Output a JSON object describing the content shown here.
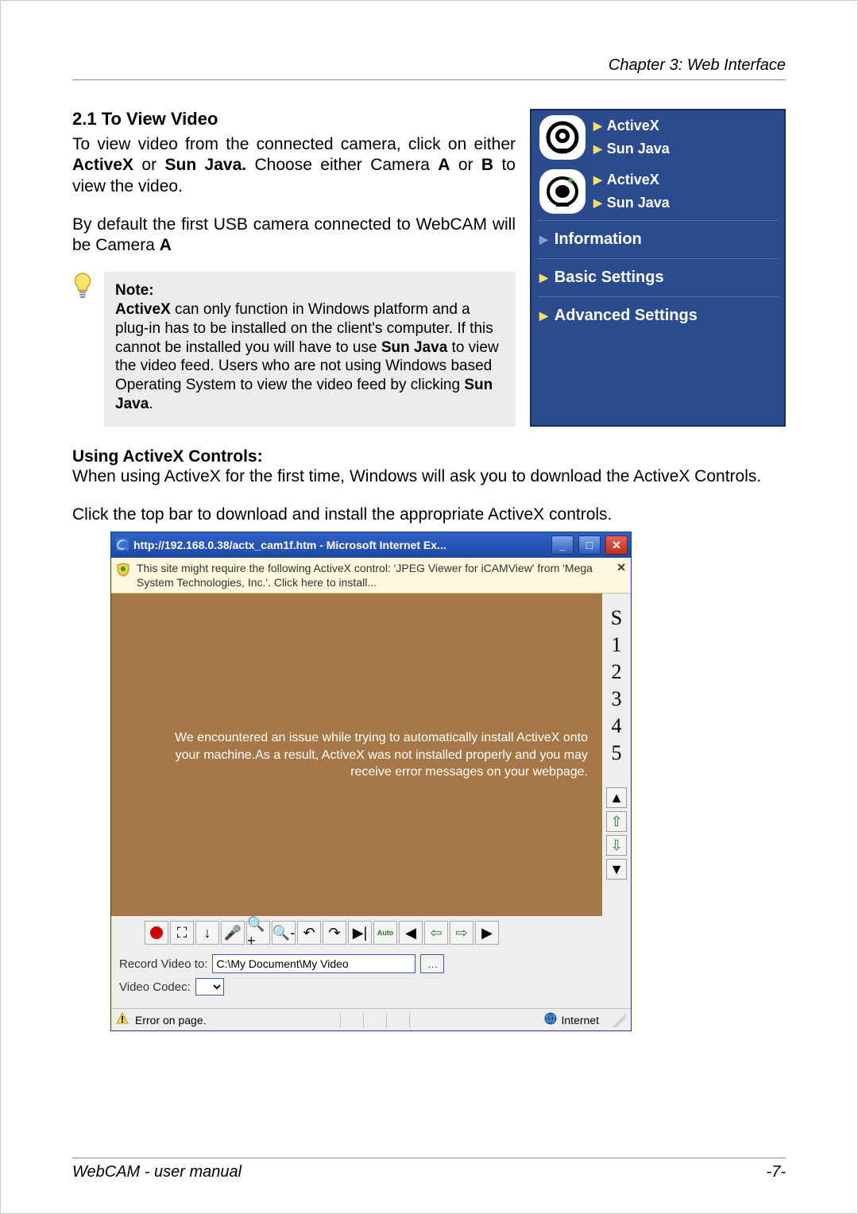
{
  "page": {
    "header_right": "Chapter 3: Web Interface",
    "footer_left": "WebCAM - user manual",
    "footer_right": "-7-"
  },
  "section": {
    "title": "2.1 To View Video",
    "p1_a": "To view video from the connected camera, click on either ",
    "p1_b": "ActiveX",
    "p1_c": " or ",
    "p1_d": "Sun Java.",
    "p1_e": "   Choose either Camera ",
    "p1_f": "A",
    "p1_g": " or ",
    "p1_h": "B",
    "p1_i": " to view the video.",
    "p2_a": "By default the first USB camera connected to WebCAM will be Camera ",
    "p2_b": "A"
  },
  "sidebar": {
    "cam1": {
      "activex": "ActiveX",
      "sunjava": "Sun Java"
    },
    "cam2": {
      "activex": "ActiveX",
      "sunjava": "Sun Java"
    },
    "sections": {
      "info": "Information",
      "basic": "Basic Settings",
      "advanced": "Advanced Settings"
    }
  },
  "note": {
    "title": "Note:",
    "b1": "ActiveX",
    "t1": " can only function in Windows platform and a plug-in has to be installed on the client's computer.   If this cannot be installed you will have to use ",
    "b2": "Sun Java",
    "t2": " to view the video feed.   Users who are not using Windows based Operating System to view the video feed by clicking ",
    "b3": "Sun Java",
    "t3": "."
  },
  "activex_section": {
    "heading": "Using ActiveX Controls:",
    "p1": "When using ActiveX for the first time, Windows will ask you to download the ActiveX Controls.",
    "p2": "Click the top bar to download and install the appropriate ActiveX controls."
  },
  "ie": {
    "title": "http://192.168.0.38/actx_cam1f.htm - Microsoft Internet Ex...",
    "infobar_msg": "This site might require the following ActiveX control: 'JPEG Viewer for iCAMView' from 'Mega System Technologies, Inc.'. Click here to install...",
    "video_error": "We encountered an issue while trying to automatically install ActiveX onto your machine.As a result, ActiveX was not installed properly and you may receive error messages on your webpage.",
    "side_labels": [
      "S",
      "1",
      "2",
      "3",
      "4",
      "5"
    ],
    "record_label": "Record Video to:",
    "record_path": "C:\\My Document\\My Video",
    "codec_label": "Video Codec:",
    "status_left": "Error on page.",
    "status_zone": "Internet",
    "toolbar_auto": "Auto"
  }
}
